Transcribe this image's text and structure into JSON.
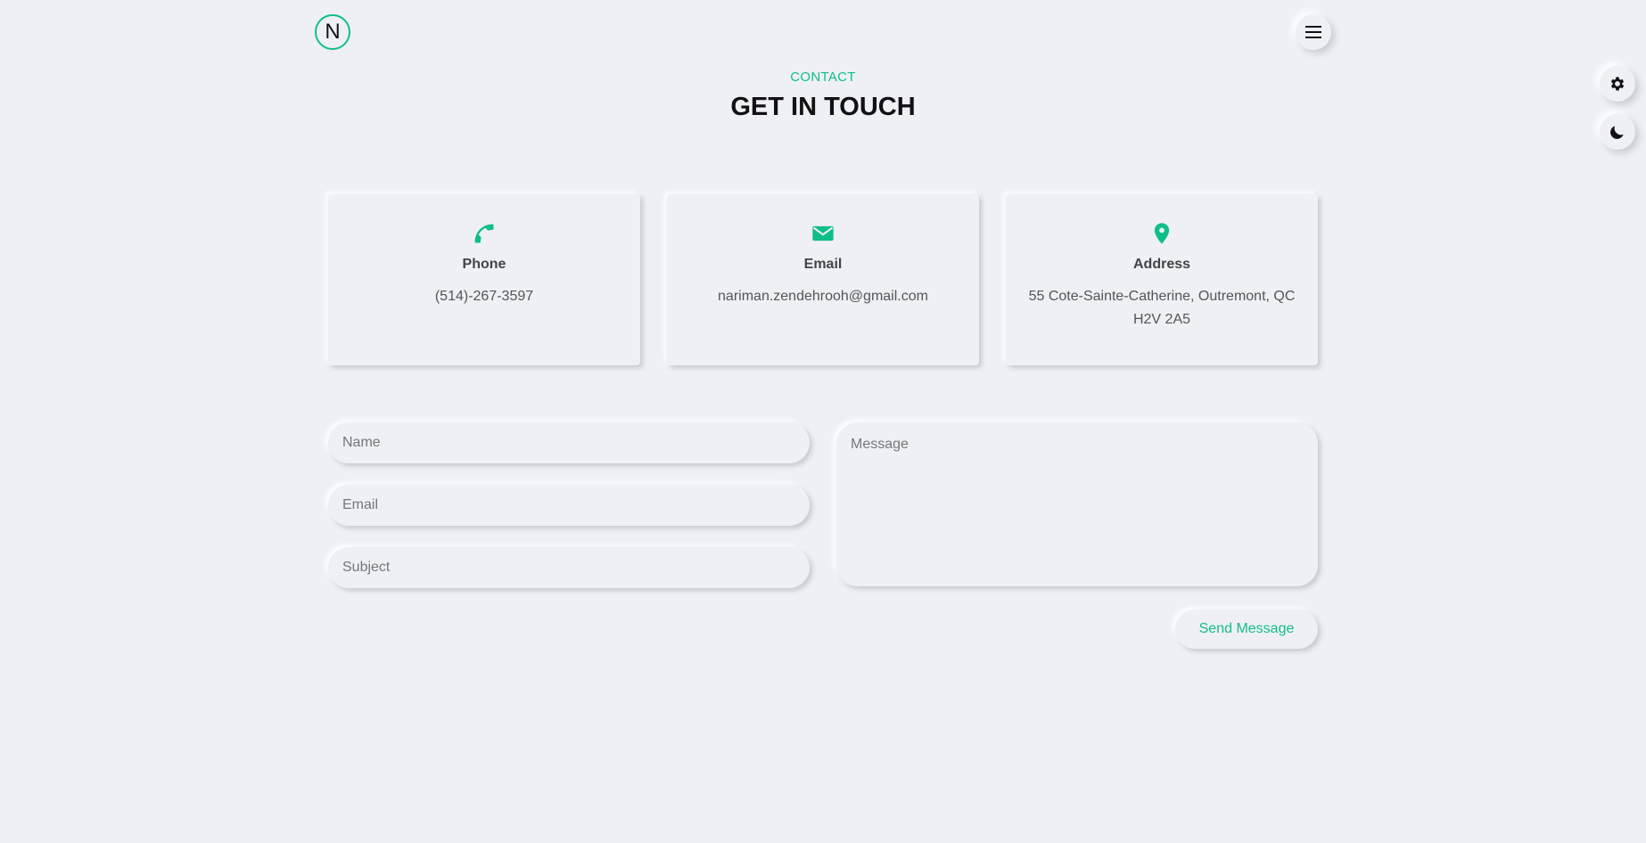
{
  "header": {
    "logo_letter": "N",
    "menu_icon": "hamburger-icon"
  },
  "side_controls": {
    "settings_icon": "gear-icon",
    "theme_icon": "moon-icon"
  },
  "section": {
    "label": "CONTACT",
    "title": "GET IN TOUCH"
  },
  "cards": [
    {
      "icon": "phone-icon",
      "title": "Phone",
      "value": "(514)-267-3597"
    },
    {
      "icon": "envelope-icon",
      "title": "Email",
      "value": "nariman.zendehrooh@gmail.com"
    },
    {
      "icon": "map-pin-icon",
      "title": "Address",
      "value": "55 Cote-Sainte-Catherine, Outremont, QC H2V 2A5"
    }
  ],
  "form": {
    "name_placeholder": "Name",
    "email_placeholder": "Email",
    "subject_placeholder": "Subject",
    "message_placeholder": "Message",
    "send_label": "Send Message"
  },
  "colors": {
    "accent": "#10bf86",
    "background": "#eef0f3",
    "heading": "#111111"
  }
}
